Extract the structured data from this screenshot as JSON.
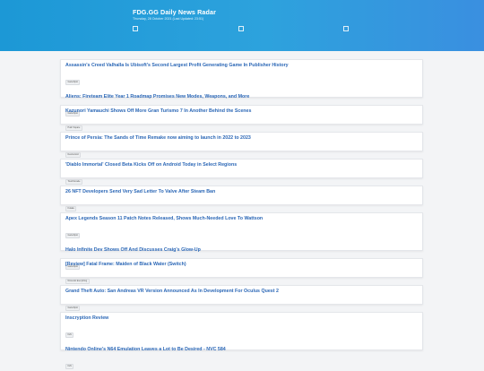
{
  "header": {
    "title": "FDG.GG Daily News Radar",
    "subtitle": "Thursday, 28 October 2021 (Last Updated: 23:51)"
  },
  "cards": [
    {
      "items": [
        {
          "title": "Assassin's Creed Valhalla Is Ubisoft's Second Largest Profit Generating Game In Publisher History",
          "source": "GameSpot"
        },
        {
          "title": "Aliens: Fireteam Elite Year 1 Roadmap Promises New Modes, Weapons, and More",
          "source": "GameSpot"
        }
      ]
    },
    {
      "items": [
        {
          "title": "Kazunori Yamauchi Shows Off More Gran Turismo 7 In Another Behind the Scenes",
          "source": "Push Square"
        }
      ]
    },
    {
      "items": [
        {
          "title": "Prince of Persia: The Sands of Time Remake now aiming to launch in 2022 to 2023",
          "source": "Destructoid"
        }
      ]
    },
    {
      "items": [
        {
          "title": "'Diablo Immortal' Closed Beta Kicks Off on Android Today in Select Regions",
          "source": "TouchArcade"
        }
      ]
    },
    {
      "items": [
        {
          "title": "26 NFT Developers Send Very Sad Letter To Valve After Steam Ban",
          "source": "Kotaku"
        }
      ]
    },
    {
      "items": [
        {
          "title": "Apex Legends Season 11 Patch Notes Released, Shows Much-Needed Love To Wattson",
          "source": "GameSpot"
        },
        {
          "title": "Halo Infinite Dev Shows Off And Discusses Craig's Glow-Up",
          "source": "GameSpot"
        }
      ]
    },
    {
      "items": [
        {
          "title": "[Review] Fatal Frame: Maiden of Black Water (Switch)",
          "source": "Nintendo Everything"
        }
      ]
    },
    {
      "items": [
        {
          "title": "Grand Theft Auto: San Andreas VR Version Announced As In Development For Oculus Quest 2",
          "source": "GameSpot"
        }
      ]
    },
    {
      "items": [
        {
          "title": "Inscryption Review",
          "source": "IGN"
        },
        {
          "title": "Nintendo Online's N64 Emulation Leaves a Lot to Be Desired - NVC 584",
          "source": "IGN"
        }
      ]
    }
  ]
}
